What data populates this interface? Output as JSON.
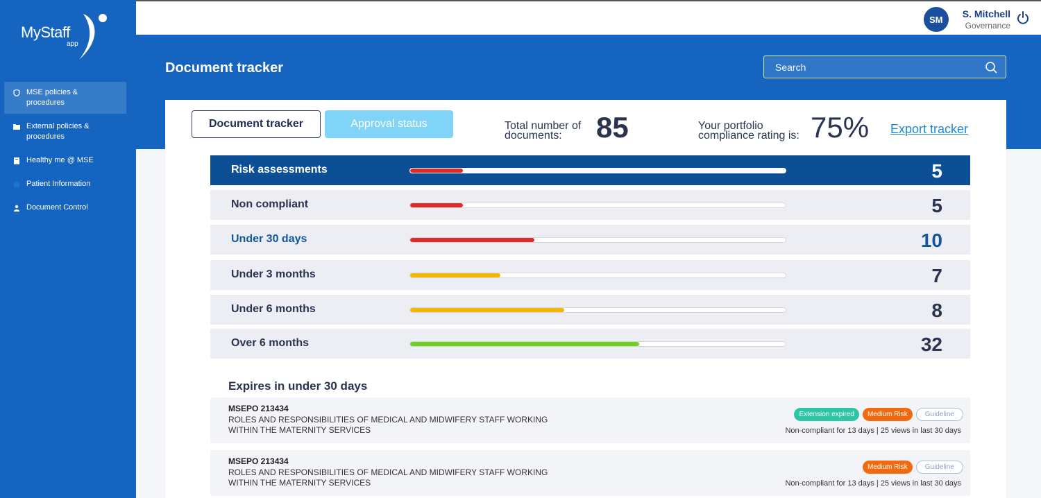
{
  "app": {
    "logo_text": "MyStaff",
    "logo_sub": "app"
  },
  "sidebar": {
    "items": [
      {
        "label": "MSE policies & procedures",
        "icon": "shield-icon",
        "active": true
      },
      {
        "label": "External policies & procedures",
        "icon": "folder-icon",
        "active": false
      },
      {
        "label": "Healthy me @ MSE",
        "icon": "book-icon",
        "active": false
      },
      {
        "label": "Patient Information",
        "icon": "info-icon",
        "active": false
      },
      {
        "label": "Document Control",
        "icon": "user-icon",
        "active": false
      }
    ]
  },
  "user": {
    "initials": "SM",
    "name": "S. Mitchell",
    "role": "Governance"
  },
  "header": {
    "title": "Document tracker",
    "search_placeholder": "Search"
  },
  "tabs": [
    {
      "label": "Document tracker"
    },
    {
      "label": "Approval status"
    }
  ],
  "stats": {
    "total_label_1": "Total number of",
    "total_label_2": "documents:",
    "total_value": "85",
    "rating_label_1": "Your portfolio",
    "rating_label_2": "compliance rating is:",
    "rating_value": "75%",
    "export_label": "Export tracker"
  },
  "categories": [
    {
      "label": "Risk assessments",
      "count": "5",
      "progress": 0.14,
      "color": "#e02a2a"
    },
    {
      "label": "Non compliant",
      "count": "5",
      "progress": 0.14,
      "color": "#e02a2a"
    },
    {
      "label": "Under 30 days",
      "count": "10",
      "progress": 0.33,
      "color": "#e02a2a"
    },
    {
      "label": "Under 3 months",
      "count": "7",
      "progress": 0.24,
      "color": "#f2b705"
    },
    {
      "label": "Under 6 months",
      "count": "8",
      "progress": 0.41,
      "color": "#f2b705"
    },
    {
      "label": "Over 6 months",
      "count": "32",
      "progress": 0.61,
      "color": "#6fcf1f"
    }
  ],
  "expires": {
    "title": "Expires in under 30 days",
    "documents": [
      {
        "code": "MSEPO 213434",
        "title": "ROLES AND RESPONSIBILITIES OF MEDICAL AND MIDWIFERY STAFF WORKING WITHIN THE MATERNITY SERVICES",
        "badges": [
          "Extension expired",
          "Medium Risk",
          "Guideline"
        ],
        "meta": "Non-compliant for 13 days | 25 views in last 30 days"
      },
      {
        "code": "MSEPO 213434",
        "title": "ROLES AND RESPONSIBILITIES OF MEDICAL AND MIDWIFERY STAFF WORKING WITHIN THE MATERNITY SERVICES",
        "badges": [
          "Medium Risk",
          "Guideline"
        ],
        "meta": "Non-compliant for 13 days | 25 views in last 30 days"
      }
    ]
  },
  "colors": {
    "brand": "#1565c0",
    "header_row": "#0d4f95",
    "extension_expired": "#2ec4a6",
    "medium_risk": "#f26a0f"
  }
}
